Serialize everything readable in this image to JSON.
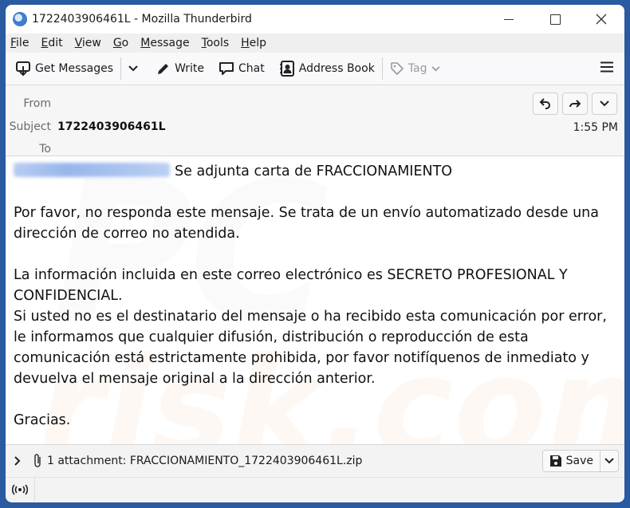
{
  "window": {
    "title": "1722403906461L - Mozilla Thunderbird",
    "controls": {
      "minimize": "minimize",
      "maximize": "maximize",
      "close": "close"
    }
  },
  "menubar": {
    "items": [
      {
        "label": "File",
        "accel": "F"
      },
      {
        "label": "Edit",
        "accel": "E"
      },
      {
        "label": "View",
        "accel": "V"
      },
      {
        "label": "Go",
        "accel": "G"
      },
      {
        "label": "Message",
        "accel": "M"
      },
      {
        "label": "Tools",
        "accel": "T"
      },
      {
        "label": "Help",
        "accel": "H"
      }
    ]
  },
  "toolbar": {
    "get_messages": "Get Messages",
    "write": "Write",
    "chat": "Chat",
    "address_book": "Address Book",
    "tag": "Tag"
  },
  "header": {
    "from_label": "From",
    "subject_label": "Subject",
    "to_label": "To",
    "subject": "1722403906461L",
    "time": "1:55 PM"
  },
  "message": {
    "sender_blurred": "[blurred email address]",
    "line1": "Se adjunta carta de FRACCIONAMIENTO",
    "para1": "Por favor, no responda este mensaje. Se trata de un envío automatizado desde una dirección de correo no atendida.",
    "para2a": "La información incluida en este correo electrónico es SECRETO PROFESIONAL Y CONFIDENCIAL.",
    "para2b": "Si usted no es el destinatario del mensaje o ha recibido esta comunicación por error, le informamos que cualquier difusión, distribución o reproducción de esta comunicación está estrictamente prohibida, por favor notifíquenos de inmediato y devuelva el mensaje original a la dirección anterior.",
    "closing": "Gracias.",
    "watermark_top": "PC",
    "watermark_bottom": "risk.com"
  },
  "attachments": {
    "summary": "1 attachment: FRACCIONAMIENTO_1722403906461L.zip",
    "save_label": "Save"
  },
  "colors": {
    "frame": "#2a5aa0",
    "accent": "#3f7ed1"
  }
}
